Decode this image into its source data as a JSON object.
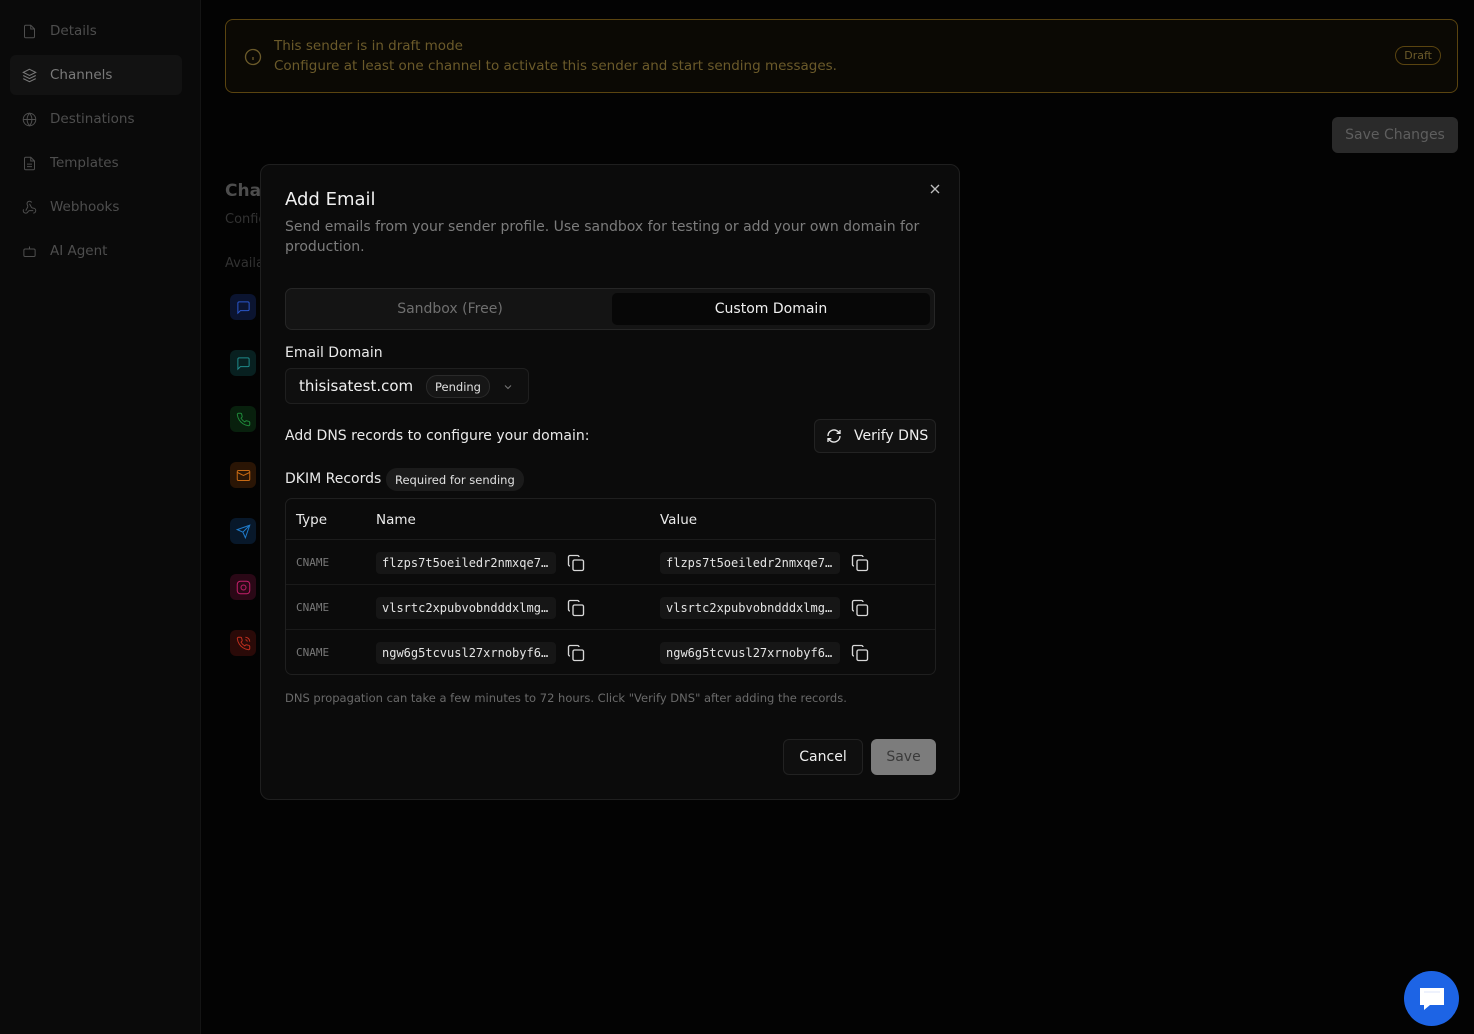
{
  "sidebar": {
    "items": [
      {
        "label": "Details",
        "icon": "file-icon"
      },
      {
        "label": "Channels",
        "icon": "layers-icon",
        "active": true
      },
      {
        "label": "Destinations",
        "icon": "globe-icon"
      },
      {
        "label": "Templates",
        "icon": "file-text-icon"
      },
      {
        "label": "Webhooks",
        "icon": "webhook-icon"
      },
      {
        "label": "AI Agent",
        "icon": "bot-icon"
      }
    ]
  },
  "banner": {
    "title": "This sender is in draft mode",
    "text": "Configure at least one channel to activate this sender and start sending messages.",
    "badge": "Draft",
    "color": "#c98a1a"
  },
  "header": {
    "save_changes": "Save Changes"
  },
  "background": {
    "title": "Channels",
    "subtitle": "Configure",
    "available": "Available"
  },
  "channel_icons": [
    {
      "icon": "message-icon",
      "color": "#2b56c9"
    },
    {
      "icon": "message-icon",
      "color": "#1f8a8a"
    },
    {
      "icon": "phone-icon",
      "color": "#1f8a3a"
    },
    {
      "icon": "mail-icon",
      "color": "#c76a14"
    },
    {
      "icon": "send-icon",
      "color": "#1f7ac9"
    },
    {
      "icon": "instagram-icon",
      "color": "#c21f6a"
    },
    {
      "icon": "phone-call-icon",
      "color": "#c22f1f"
    }
  ],
  "modal": {
    "title": "Add Email",
    "description": "Send emails from your sender profile. Use sandbox for testing or add your own domain for production.",
    "tabs": [
      {
        "label": "Sandbox (Free)",
        "active": false
      },
      {
        "label": "Custom Domain",
        "active": true
      }
    ],
    "domain_label": "Email Domain",
    "domain_value": "thisisatest.com",
    "domain_status": "Pending",
    "dns_label": "Add DNS records to configure your domain:",
    "verify_label": "Verify DNS",
    "dkim_label": "DKIM Records",
    "dkim_badge": "Required for sending",
    "table": {
      "headers": [
        "Type",
        "Name",
        "Value"
      ],
      "rows": [
        {
          "type": "CNAME",
          "name": "flzps7t5oeiledr2nmxqe7…",
          "value": "flzps7t5oeiledr2nmxqe7…"
        },
        {
          "type": "CNAME",
          "name": "vlsrtc2xpubvobndddxlmg…",
          "value": "vlsrtc2xpubvobndddxlmg…"
        },
        {
          "type": "CNAME",
          "name": "ngw6g5tcvusl27xrnobyf6…",
          "value": "ngw6g5tcvusl27xrnobyf6…"
        }
      ]
    },
    "note": "DNS propagation can take a few minutes to 72 hours. Click \"Verify DNS\" after adding the records.",
    "cancel_label": "Cancel",
    "save_label": "Save"
  },
  "chat": {
    "icon": "chat-icon",
    "color": "#1d64e5"
  }
}
